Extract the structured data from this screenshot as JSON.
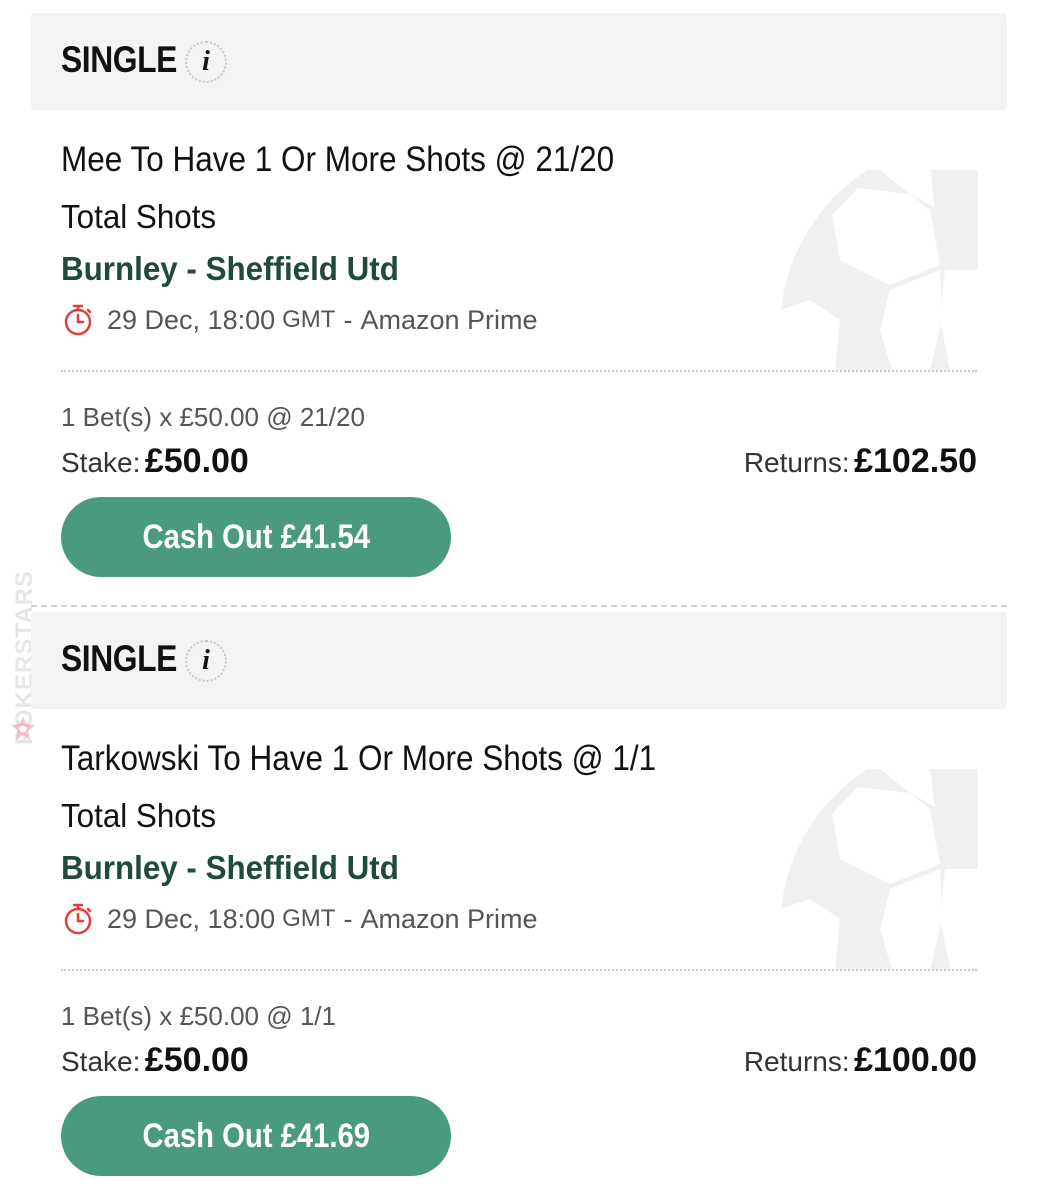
{
  "watermark": {
    "text": "POKERSTARS"
  },
  "colors": {
    "header_bg": "#f3f3f3",
    "event_green": "#1f4a3c",
    "cashout_green": "#4a9a81",
    "clock_red": "#e0403a"
  },
  "bets": [
    {
      "type": "SINGLE",
      "info_icon": "i",
      "selection": "Mee To Have 1 Or More Shots @ 21/20",
      "market": "Total Shots",
      "event": "Burnley - Sheffield Utd",
      "datetime": "29 Dec, 18:00",
      "timezone": "GMT",
      "separator": "-",
      "channel": "Amazon Prime",
      "summary": "1 Bet(s) x £50.00 @ 21/20",
      "stake_label": "Stake:",
      "stake_value": "£50.00",
      "returns_label": "Returns:",
      "returns_value": "£102.50",
      "cashout_label": "Cash Out £41.54"
    },
    {
      "type": "SINGLE",
      "info_icon": "i",
      "selection": "Tarkowski To Have 1 Or More Shots @ 1/1",
      "market": "Total Shots",
      "event": "Burnley - Sheffield Utd",
      "datetime": "29 Dec, 18:00",
      "timezone": "GMT",
      "separator": "-",
      "channel": "Amazon Prime",
      "summary": "1 Bet(s) x £50.00 @ 1/1",
      "stake_label": "Stake:",
      "stake_value": "£50.00",
      "returns_label": "Returns:",
      "returns_value": "£100.00",
      "cashout_label": "Cash Out £41.69"
    }
  ]
}
